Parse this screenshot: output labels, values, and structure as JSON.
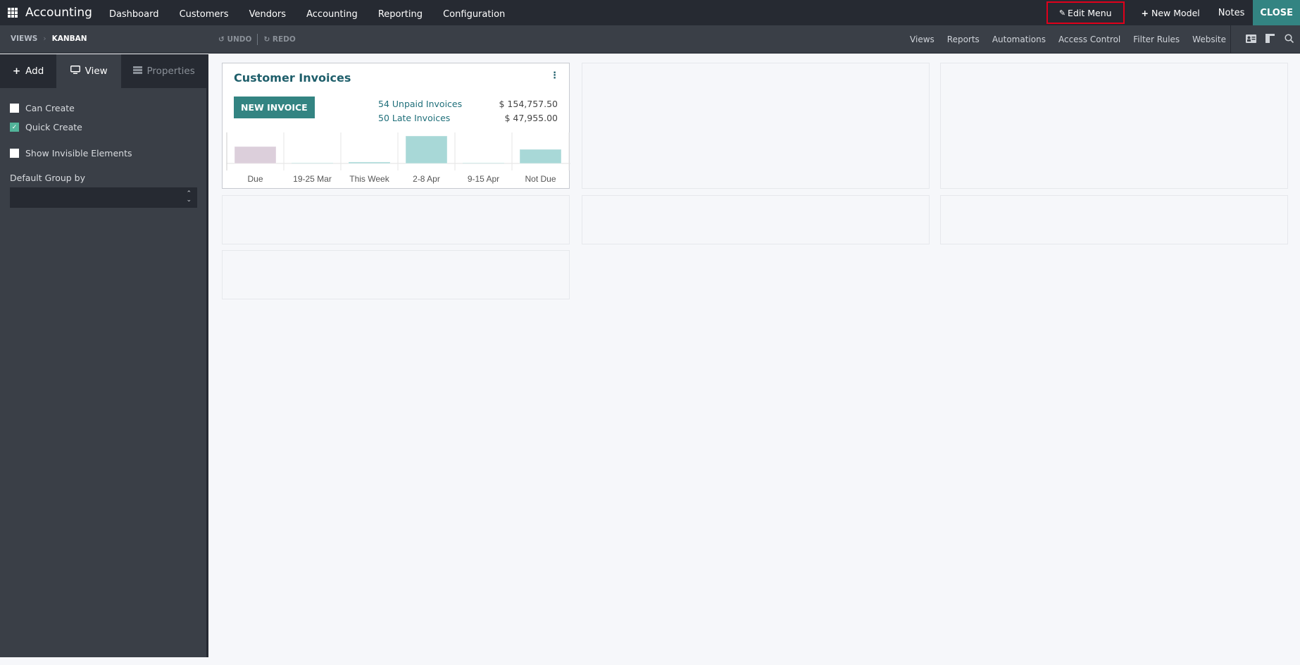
{
  "topbar": {
    "app_title": "Accounting",
    "nav": [
      "Dashboard",
      "Customers",
      "Vendors",
      "Accounting",
      "Reporting",
      "Configuration"
    ],
    "edit_menu": "Edit Menu",
    "new_model": "New Model",
    "notes": "Notes",
    "close": "CLOSE"
  },
  "subbar": {
    "breadcrumb": [
      "VIEWS",
      "KANBAN"
    ],
    "undo": "UNDO",
    "redo": "REDO",
    "links": [
      "Views",
      "Reports",
      "Automations",
      "Access Control",
      "Filter Rules",
      "Website"
    ],
    "icons": [
      "contact-card-icon",
      "layout-icon",
      "search-icon"
    ]
  },
  "sidebar": {
    "tabs": [
      "Add",
      "View",
      "Properties"
    ],
    "active_tab": "View",
    "checkboxes": [
      {
        "label": "Can Create",
        "checked": false
      },
      {
        "label": "Quick Create",
        "checked": true
      },
      {
        "label": "Show Invisible Elements",
        "checked": false
      }
    ],
    "default_group_label": "Default Group by",
    "default_group_value": ""
  },
  "card": {
    "title": "Customer Invoices",
    "button": "NEW INVOICE",
    "stats": [
      {
        "label": "54 Unpaid Invoices",
        "amount": "$ 154,757.50"
      },
      {
        "label": "50 Late Invoices",
        "amount": "$ 47,955.00"
      }
    ]
  },
  "chart_data": {
    "type": "bar",
    "categories": [
      "Due",
      "19-25 Mar",
      "This Week",
      "2-8 Apr",
      "9-15 Apr",
      "Not Due"
    ],
    "values": [
      24,
      0,
      2,
      39,
      0,
      20
    ],
    "colors": [
      "#dccfdb",
      "#a8d8d7",
      "#a8d8d7",
      "#a8d8d7",
      "#a8d8d7",
      "#a8d8d7"
    ],
    "title": "",
    "xlabel": "",
    "ylabel": "",
    "ylim": [
      0,
      42
    ],
    "grid": true
  },
  "colors": {
    "accent": "#338482",
    "topbar": "#262a32",
    "sidebar": "#3a3f47",
    "highlight": "#e0001b"
  }
}
